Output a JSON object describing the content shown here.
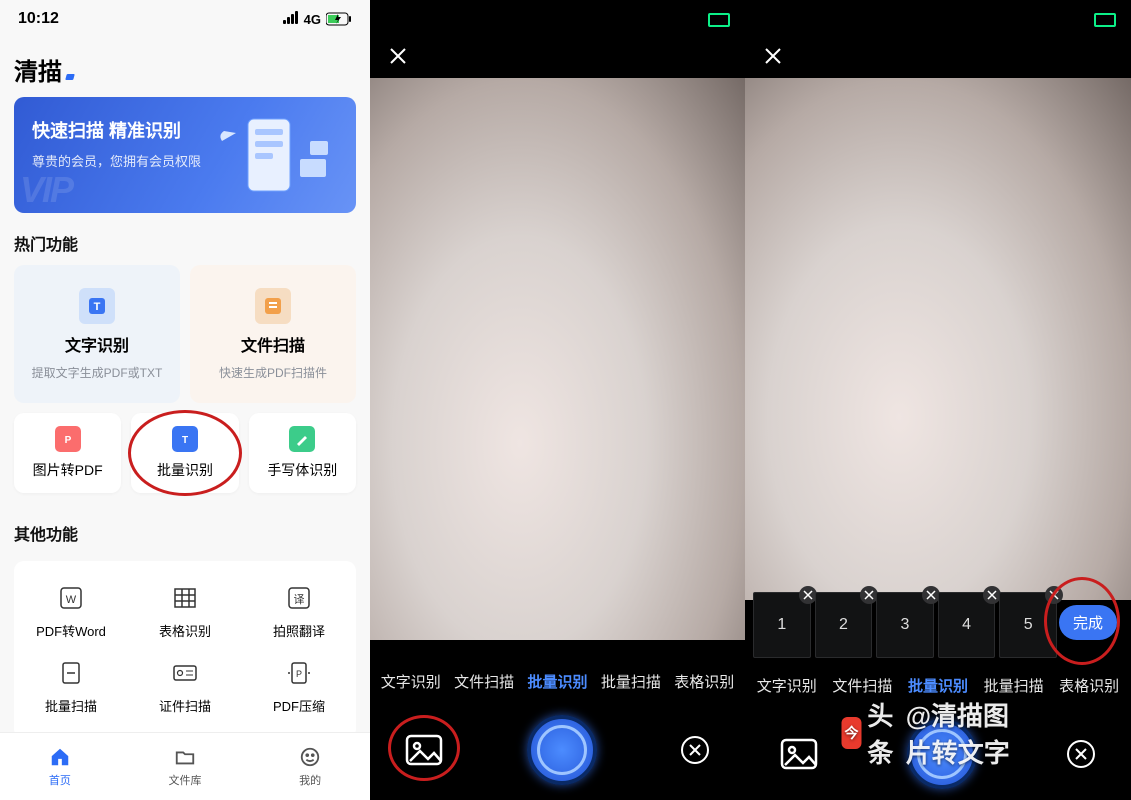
{
  "status": {
    "time": "10:12",
    "network": "4G"
  },
  "brand": "清描",
  "vip": {
    "title": "快速扫描 精准识别",
    "subtitle": "尊贵的会员，您拥有会员权限",
    "watermark": "VIP"
  },
  "section_hot": "热门功能",
  "hot": [
    {
      "name": "text-ocr",
      "label": "文字识别",
      "desc": "提取文字生成PDF或TXT"
    },
    {
      "name": "file-scan",
      "label": "文件扫描",
      "desc": "快速生成PDF扫描件"
    }
  ],
  "mid": [
    {
      "name": "img-to-pdf",
      "label": "图片转PDF"
    },
    {
      "name": "batch-ocr",
      "label": "批量识别"
    },
    {
      "name": "handwriting-ocr",
      "label": "手写体识别"
    }
  ],
  "section_other": "其他功能",
  "other": [
    {
      "name": "pdf-to-word",
      "label": "PDF转Word"
    },
    {
      "name": "table-ocr",
      "label": "表格识别"
    },
    {
      "name": "photo-translate",
      "label": "拍照翻译"
    },
    {
      "name": "batch-scan",
      "label": "批量扫描"
    },
    {
      "name": "id-scan",
      "label": "证件扫描"
    },
    {
      "name": "pdf-compress",
      "label": "PDF压缩"
    }
  ],
  "tabs": [
    {
      "name": "home",
      "label": "首页",
      "active": true
    },
    {
      "name": "files",
      "label": "文件库"
    },
    {
      "name": "mine",
      "label": "我的"
    }
  ],
  "modes": [
    {
      "name": "text-ocr",
      "label": "文字识别"
    },
    {
      "name": "file-scan",
      "label": "文件扫描"
    },
    {
      "name": "batch-ocr",
      "label": "批量识别",
      "active": true
    },
    {
      "name": "batch-scan",
      "label": "批量扫描"
    },
    {
      "name": "table-ocr",
      "label": "表格识别"
    }
  ],
  "thumbs": [
    "1",
    "2",
    "3",
    "4",
    "5"
  ],
  "done": "完成",
  "watermark": {
    "logo_text": "头条",
    "handle": "@清描图片转文字"
  },
  "colors": {
    "primary": "#3a75f3",
    "annotation": "#c91e1e"
  }
}
